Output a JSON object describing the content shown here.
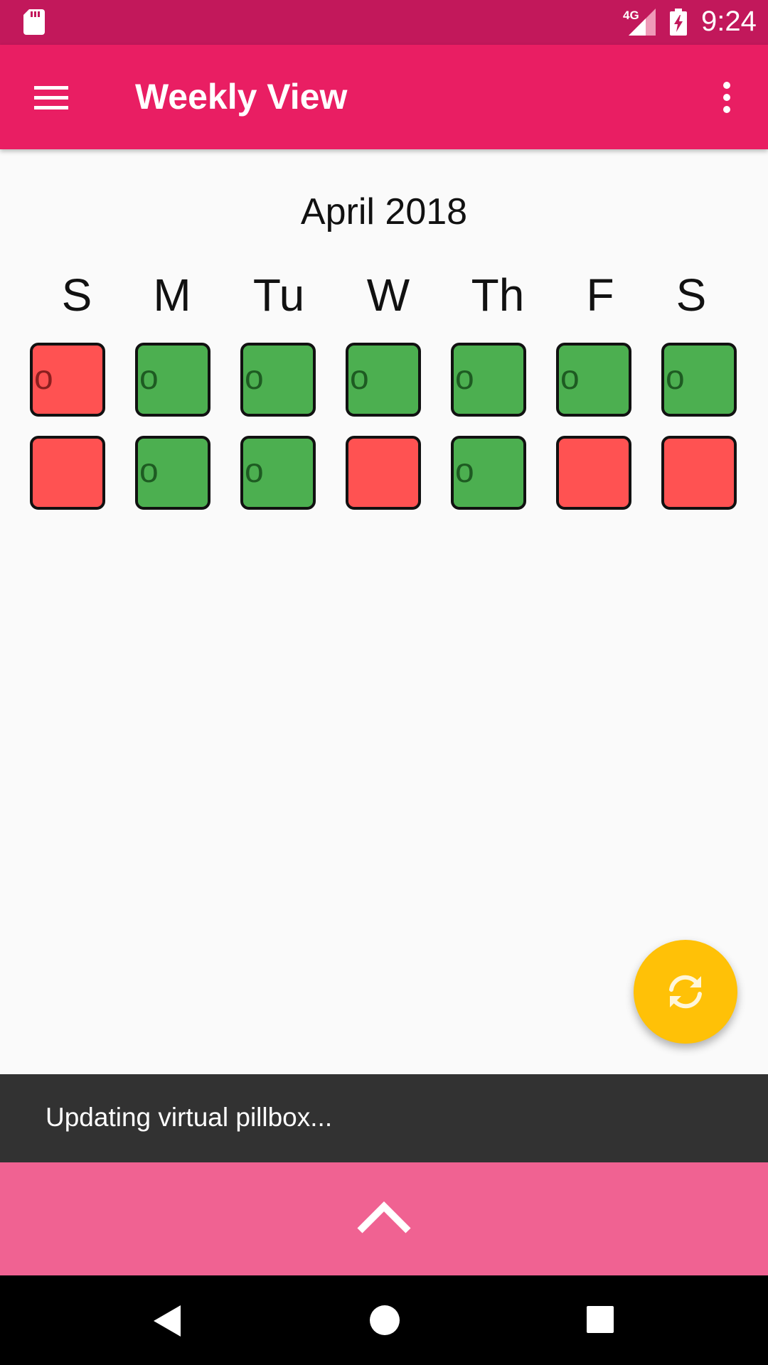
{
  "status_bar": {
    "time": "9:24",
    "network": "4G",
    "icons": [
      "sd-card-icon",
      "signal-icon",
      "battery-charging-icon"
    ]
  },
  "app_bar": {
    "title": "Weekly View",
    "icons": [
      "menu-icon",
      "more-vert-icon"
    ],
    "color": "#e91e63"
  },
  "calendar": {
    "month_label": "April 2018",
    "days": [
      "S",
      "M",
      "Tu",
      "W",
      "Th",
      "F",
      "S"
    ],
    "weeks": [
      [
        {
          "status": "red",
          "mark": "o"
        },
        {
          "status": "green",
          "mark": "o"
        },
        {
          "status": "green",
          "mark": "o"
        },
        {
          "status": "green",
          "mark": "o"
        },
        {
          "status": "green",
          "mark": "o"
        },
        {
          "status": "green",
          "mark": "o"
        },
        {
          "status": "green",
          "mark": "o"
        }
      ],
      [
        {
          "status": "red",
          "mark": ""
        },
        {
          "status": "green",
          "mark": "o"
        },
        {
          "status": "green",
          "mark": "o"
        },
        {
          "status": "red",
          "mark": ""
        },
        {
          "status": "green",
          "mark": "o"
        },
        {
          "status": "red",
          "mark": ""
        },
        {
          "status": "red",
          "mark": ""
        }
      ]
    ],
    "colors": {
      "green": "#4caf50",
      "red": "#ff5252"
    }
  },
  "fab": {
    "icon": "refresh-icon",
    "color": "#ffc107"
  },
  "snackbar": {
    "message": "Updating virtual pillbox..."
  },
  "bottom_panel": {
    "icon": "chevron-up-icon",
    "color": "#f06292"
  },
  "nav_bar": {
    "icons": [
      "back-icon",
      "home-icon",
      "recents-icon"
    ]
  }
}
